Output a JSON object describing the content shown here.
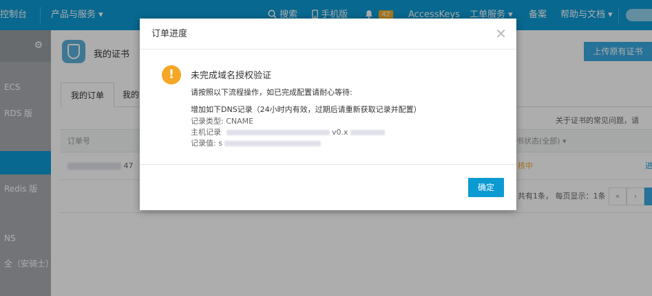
{
  "topbar": {
    "console": "控制台",
    "products": "产品与服务",
    "search": "搜索",
    "mobile": "手机版",
    "notify_count": "42",
    "accesskeys": "AccessKeys",
    "tickets": "工单服务",
    "filing": "备案",
    "help": "帮助与文档"
  },
  "sidebar": {
    "items": [
      "ECS",
      "RDS 版",
      "Redis 版",
      "NS",
      "全（安骑士）"
    ]
  },
  "main": {
    "page_title": "我的证书",
    "upload_label": "上传原有证书",
    "tabs": [
      "我的订单",
      "我的证"
    ],
    "help_text": "关于证书的常见问题，请",
    "table": {
      "col_order": "订单号",
      "col_status": "书状态(全部)",
      "row_order_tail": "47",
      "row_status": "核中",
      "row_action": "进"
    },
    "pager": {
      "text": "共有1条，  每页显示：1条",
      "first": "«",
      "prev": "‹"
    }
  },
  "dialog": {
    "title": "订单进度",
    "message_title": "未完成域名授权验证",
    "instruction": "请按照以下流程操作，如已完成配置请耐心等待:",
    "dns_heading": "增加如下DNS记录（24小时内有效，过期后请重新获取记录并配置）",
    "record_type_label": "记录类型:",
    "record_type_value": "CNAME",
    "host_label": "主机记录",
    "host_partial": "v0.x",
    "value_label": "记录值:",
    "value_partial": "s",
    "ok_label": "确定"
  }
}
